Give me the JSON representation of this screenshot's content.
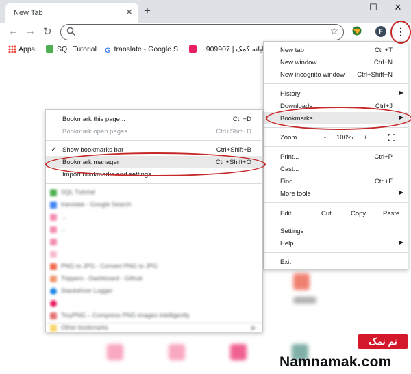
{
  "window": {
    "tab_title": "New Tab",
    "tab_close": "✕",
    "new_tab": "+",
    "minimize": "—",
    "maximize": "☐",
    "close": "✕"
  },
  "toolbar": {
    "back": "←",
    "forward": "→",
    "reload": "↻",
    "star": "☆",
    "avatar_letter": "F",
    "menu_icon": "⋮"
  },
  "bookmarks_bar": {
    "apps": "Apps",
    "items": [
      "SQL Tutorial",
      "translate - Google S...",
      "...909907 | ایانه کمک"
    ]
  },
  "main_menu": {
    "new_tab": {
      "label": "New tab",
      "shortcut": "Ctrl+T"
    },
    "new_window": {
      "label": "New window",
      "shortcut": "Ctrl+N"
    },
    "new_incognito": {
      "label": "New incognito window",
      "shortcut": "Ctrl+Shift+N"
    },
    "history": {
      "label": "History"
    },
    "downloads": {
      "label": "Downloads",
      "shortcut": "Ctrl+J"
    },
    "bookmarks": {
      "label": "Bookmarks"
    },
    "zoom": {
      "label": "Zoom",
      "minus": "-",
      "value": "100%",
      "plus": "+"
    },
    "print": {
      "label": "Print...",
      "shortcut": "Ctrl+P"
    },
    "cast": {
      "label": "Cast..."
    },
    "find": {
      "label": "Find...",
      "shortcut": "Ctrl+F"
    },
    "more_tools": {
      "label": "More tools"
    },
    "edit": {
      "label": "Edit",
      "cut": "Cut",
      "copy": "Copy",
      "paste": "Paste"
    },
    "settings": {
      "label": "Settings"
    },
    "help": {
      "label": "Help"
    },
    "exit": {
      "label": "Exit"
    }
  },
  "bookmarks_menu": {
    "bookmark_page": {
      "label": "Bookmark this page...",
      "shortcut": "Ctrl+D"
    },
    "bookmark_open_pages": {
      "label": "Bookmark open pages...",
      "shortcut": "Ctrl+Shift+D"
    },
    "show_bar": {
      "label": "Show bookmarks bar",
      "shortcut": "Ctrl+Shift+B"
    },
    "manager": {
      "label": "Bookmark manager",
      "shortcut": "Ctrl+Shift+O"
    },
    "import": {
      "label": "Import bookmarks and settings..."
    },
    "blurred_items": [
      "SQL Tutorial",
      "translate - Google Search",
      "...",
      "...",
      "",
      "",
      "PNG to JPG - Convert PNG to JPG",
      "Trippers - Dashboard - Github",
      "Stackdriver Logger",
      "",
      "TinyPNG – Compress PNG images intelligently",
      "Other bookmarks"
    ]
  },
  "watermark": {
    "badge": "نم نمک",
    "site": "Namnamak.com"
  }
}
